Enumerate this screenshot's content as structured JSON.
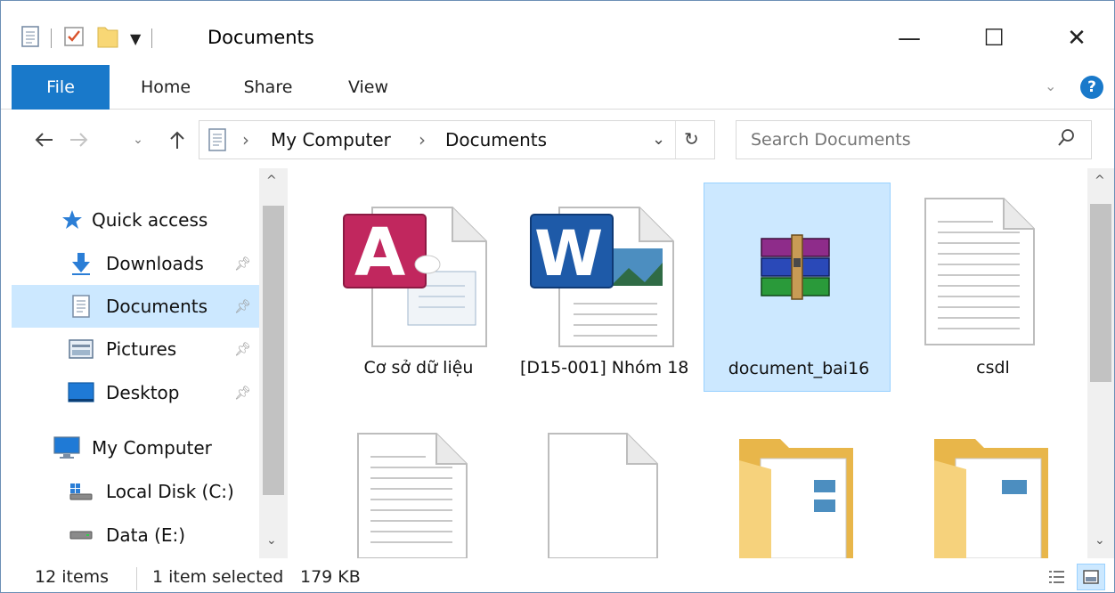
{
  "window": {
    "title": "Documents",
    "accent": "#1979ca",
    "selection_color": "#cce8ff"
  },
  "quick_access_toolbar": {
    "icons": [
      "properties-icon",
      "checklist-icon",
      "new-folder-icon",
      "customize-dropdown-icon"
    ]
  },
  "window_controls": {
    "minimize": "—",
    "maximize": "☐",
    "close": "✕"
  },
  "ribbon": {
    "tabs": [
      {
        "label": "File",
        "active": true
      },
      {
        "label": "Home"
      },
      {
        "label": "Share"
      },
      {
        "label": "View"
      }
    ],
    "help_icon": "?"
  },
  "address": {
    "path": [
      "My Computer",
      "Documents"
    ],
    "separator": "›"
  },
  "search": {
    "placeholder": "Search Documents"
  },
  "nav": {
    "quick_access": "Quick access",
    "items": [
      {
        "label": "Downloads",
        "icon": "download-arrow-icon",
        "pinned": true
      },
      {
        "label": "Documents",
        "icon": "documents-icon",
        "pinned": true,
        "selected": true
      },
      {
        "label": "Pictures",
        "icon": "pictures-icon",
        "pinned": true
      },
      {
        "label": "Desktop",
        "icon": "desktop-icon",
        "pinned": true
      }
    ],
    "my_computer": "My Computer",
    "drives": [
      {
        "label": "Local Disk (C:)",
        "icon": "windows-drive-icon"
      },
      {
        "label": "Data (E:)",
        "icon": "drive-icon"
      }
    ]
  },
  "files": [
    {
      "name": "Cơ sở dữ liệu",
      "icon": "access-file-icon"
    },
    {
      "name": "[D15-001] Nhóm 18",
      "icon": "word-file-icon"
    },
    {
      "name": "document_bai16",
      "icon": "winrar-archive-icon",
      "selected": true
    },
    {
      "name": "csdl",
      "icon": "text-file-icon"
    },
    {
      "name": "",
      "icon": "text-file-icon"
    },
    {
      "name": "",
      "icon": "blank-file-icon"
    },
    {
      "name": "",
      "icon": "folder-icon"
    },
    {
      "name": "",
      "icon": "folder-icon"
    }
  ],
  "status": {
    "item_count": "12 items",
    "selection": "1 item selected",
    "size": "179 KB"
  }
}
